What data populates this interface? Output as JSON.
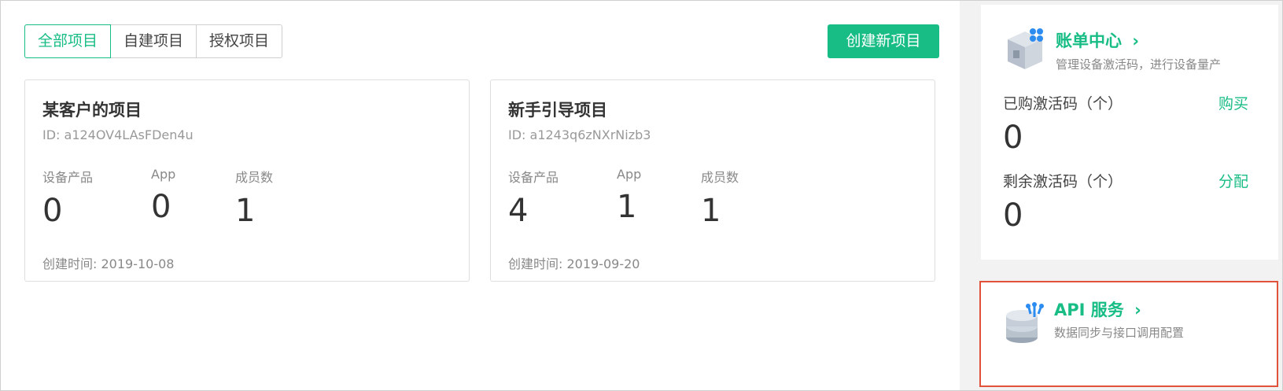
{
  "tabs": [
    {
      "label": "全部项目",
      "active": true
    },
    {
      "label": "自建项目",
      "active": false
    },
    {
      "label": "授权项目",
      "active": false
    }
  ],
  "create_button_label": "创建新项目",
  "projects": [
    {
      "name": "某客户的项目",
      "id_text": "ID: a124OV4LAsFDen4u",
      "stats": [
        {
          "label": "设备产品",
          "value": "0"
        },
        {
          "label": "App",
          "value": "0"
        },
        {
          "label": "成员数",
          "value": "1"
        }
      ],
      "created": "创建时间: 2019-10-08"
    },
    {
      "name": "新手引导项目",
      "id_text": "ID: a1243q6zNXrNizb3",
      "stats": [
        {
          "label": "设备产品",
          "value": "4"
        },
        {
          "label": "App",
          "value": "1"
        },
        {
          "label": "成员数",
          "value": "1"
        }
      ],
      "created": "创建时间: 2019-09-20"
    }
  ],
  "billing": {
    "title": "账单中心",
    "subtitle": "管理设备激活码，进行设备量产",
    "icon": "billing-box-icon",
    "purchased_label": "已购激活码（个）",
    "purchased_value": "0",
    "purchased_action": "购买",
    "remaining_label": "剩余激活码（个）",
    "remaining_value": "0",
    "remaining_action": "分配"
  },
  "api": {
    "title": "API 服务",
    "subtitle": "数据同步与接口调用配置",
    "icon": "api-database-icon"
  },
  "colors": {
    "accent": "#18bc85",
    "highlight_border": "#e0533a"
  }
}
